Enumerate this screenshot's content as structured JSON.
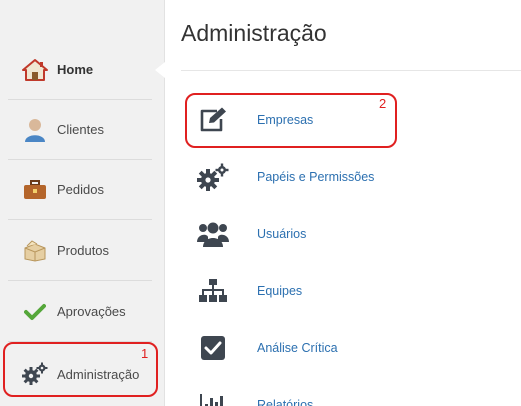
{
  "sidebar": {
    "items": [
      {
        "label": "Home",
        "icon": "home-icon"
      },
      {
        "label": "Clientes",
        "icon": "user-icon"
      },
      {
        "label": "Pedidos",
        "icon": "briefcase-icon"
      },
      {
        "label": "Produtos",
        "icon": "box-icon"
      },
      {
        "label": "Aprovações",
        "icon": "check-icon"
      },
      {
        "label": "Administração",
        "icon": "gears-icon"
      }
    ],
    "active_index": 0
  },
  "main": {
    "title": "Administração",
    "items": [
      {
        "label": "Empresas",
        "icon": "edit-icon"
      },
      {
        "label": "Papéis e Permissões",
        "icon": "gears-icon"
      },
      {
        "label": "Usuários",
        "icon": "users-icon"
      },
      {
        "label": "Equipes",
        "icon": "sitemap-icon"
      },
      {
        "label": "Análise Crítica",
        "icon": "checkbox-icon"
      },
      {
        "label": "Relatórios",
        "icon": "bar-chart-icon"
      }
    ]
  },
  "callouts": [
    {
      "number": "1"
    },
    {
      "number": "2"
    }
  ],
  "colors": {
    "link": "#2c70b0",
    "callout": "#e02020",
    "icon_dark": "#3e4650",
    "check_green": "#55a73a"
  }
}
